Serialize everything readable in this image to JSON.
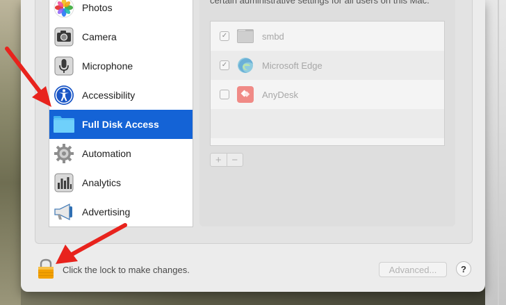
{
  "header": {
    "text": "certain administrative settings for all users on this Mac."
  },
  "sidebar": {
    "items": [
      {
        "label": "Photos",
        "icon": "photos-icon",
        "selected": false
      },
      {
        "label": "Camera",
        "icon": "camera-icon",
        "selected": false
      },
      {
        "label": "Microphone",
        "icon": "microphone-icon",
        "selected": false
      },
      {
        "label": "Accessibility",
        "icon": "accessibility-icon",
        "selected": false
      },
      {
        "label": "Full Disk Access",
        "icon": "folder-icon",
        "selected": true
      },
      {
        "label": "Automation",
        "icon": "gear-icon",
        "selected": false
      },
      {
        "label": "Analytics",
        "icon": "analytics-icon",
        "selected": false
      },
      {
        "label": "Advertising",
        "icon": "megaphone-icon",
        "selected": false
      }
    ]
  },
  "apps": {
    "rows": [
      {
        "name": "smbd",
        "checked": true,
        "icon": "terminal-icon"
      },
      {
        "name": "Microsoft Edge",
        "checked": true,
        "icon": "edge-icon"
      },
      {
        "name": "AnyDesk",
        "checked": false,
        "icon": "anydesk-icon"
      }
    ]
  },
  "controls": {
    "add_label": "+",
    "remove_label": "−"
  },
  "footer": {
    "lock_text": "Click the lock to make changes.",
    "advanced_label": "Advanced...",
    "help_label": "?"
  },
  "colors": {
    "selection": "#1463d6",
    "arrow": "#e8231d",
    "lock": "#f2a000"
  }
}
